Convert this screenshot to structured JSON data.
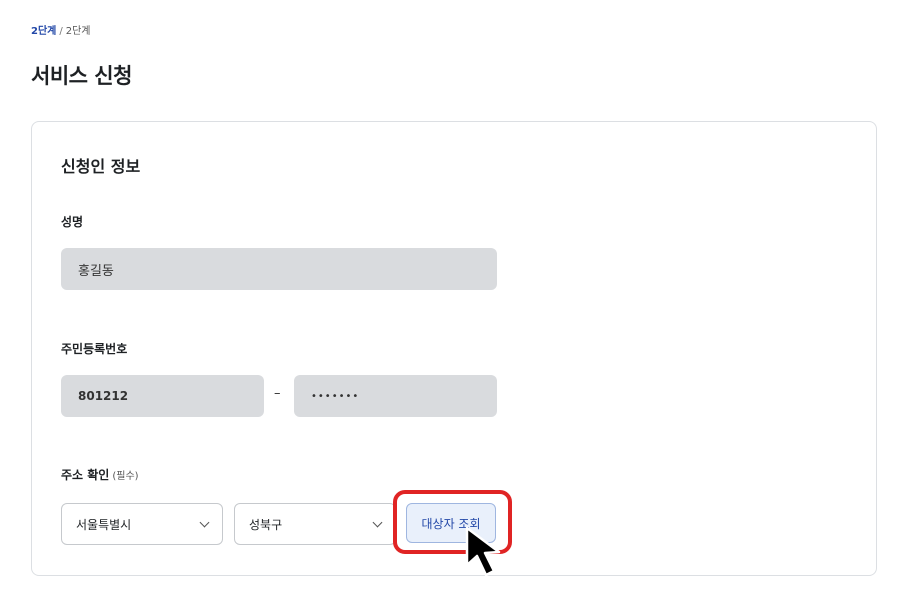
{
  "breadcrumb": {
    "current": "2단계",
    "separator": "/",
    "step": "2단계"
  },
  "page": {
    "title": "서비스 신청"
  },
  "section": {
    "title": "신청인 정보"
  },
  "name_field": {
    "label": "성명",
    "value": "홍길동"
  },
  "rrn_field": {
    "label": "주민등록번호",
    "front_value": "801212",
    "separator": "–",
    "back_value": "•••••••"
  },
  "address": {
    "label": "주소 확인",
    "required_hint": "(필수)",
    "city_select": {
      "value": "서울특별시"
    },
    "district_select": {
      "value": "성북구"
    },
    "lookup_button": "대상자 조회"
  },
  "colors": {
    "accent": "#2348a8",
    "highlight": "#e02424",
    "field_bg": "#d9dbde"
  }
}
